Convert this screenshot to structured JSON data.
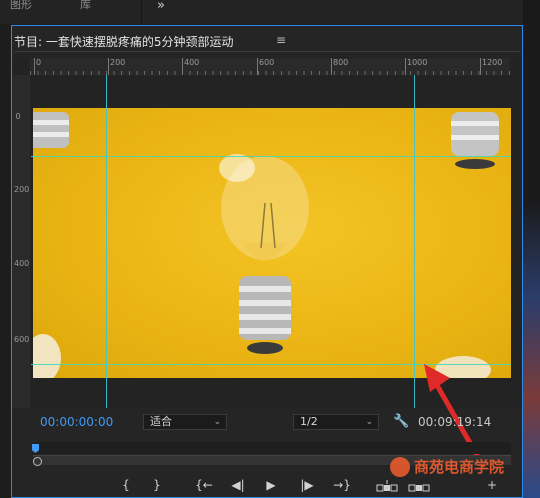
{
  "top_tabs": [
    "图形",
    "库"
  ],
  "top_overflow": "»",
  "panel": {
    "title": "节目: 一套快速摆脱疼痛的5分钟颈部运动",
    "menu_icon": "≡"
  },
  "ruler": {
    "h_labels": [
      "0",
      "200",
      "400",
      "600",
      "800",
      "1000",
      "1200"
    ],
    "v_labels": [
      "0",
      "200",
      "400",
      "600"
    ]
  },
  "timecode": {
    "current": "00:00:00:00",
    "duration": "00:09:19:14"
  },
  "fit": {
    "value": "适合"
  },
  "resolution": {
    "value": "1/2"
  },
  "transport": {
    "buttons": [
      "{",
      "}",
      "{←",
      "◀|",
      "▶",
      "|▶",
      "→}",
      "",
      "",
      "+"
    ]
  },
  "watermark": {
    "text": "商苑电商学院"
  },
  "colors": {
    "accent": "#3f9bf5",
    "video_bg": "#eab514",
    "guide": "#38c7d4",
    "arrow": "#e02a2a"
  },
  "icons": [
    "wrench-icon",
    "hamburger-menu-icon",
    "chevron-down-icon",
    "lightbulb-image"
  ]
}
